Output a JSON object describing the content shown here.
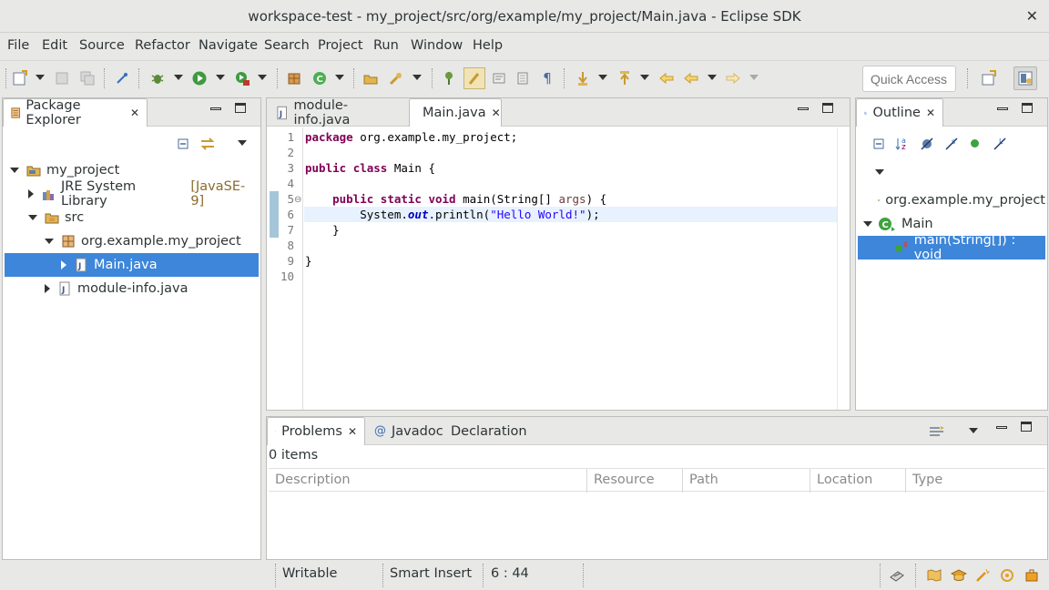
{
  "window": {
    "title": "workspace-test - my_project/src/org/example/my_project/Main.java - Eclipse SDK",
    "close_label": "✕"
  },
  "menu": [
    "File",
    "Edit",
    "Source",
    "Refactor",
    "Navigate",
    "Search",
    "Project",
    "Run",
    "Window",
    "Help"
  ],
  "toolbar": {
    "quick_access_placeholder": "Quick Access"
  },
  "package_explorer": {
    "tab_label": "Package Explorer",
    "tree": [
      {
        "label": "my_project",
        "decoration": ""
      },
      {
        "label": "JRE System Library",
        "decoration": "[JavaSE-9]"
      },
      {
        "label": "src",
        "decoration": ""
      },
      {
        "label": "org.example.my_project",
        "decoration": ""
      },
      {
        "label": "Main.java",
        "decoration": ""
      },
      {
        "label": "module-info.java",
        "decoration": ""
      }
    ]
  },
  "editor": {
    "tabs": [
      "module-info.java",
      "Main.java"
    ],
    "line_numbers": [
      "1",
      "2",
      "3",
      "4",
      "5",
      "6",
      "7",
      "8",
      "9",
      "10"
    ]
  },
  "outline": {
    "tab_label": "Outline",
    "items": [
      {
        "label": "org.example.my_project"
      },
      {
        "label": "Main"
      },
      {
        "label": "main(String[]) : void"
      }
    ]
  },
  "problems": {
    "tabs": [
      "Problems",
      "Javadoc",
      "Declaration"
    ],
    "count": "0 items",
    "columns": [
      "Description",
      "Resource",
      "Path",
      "Location",
      "Type"
    ]
  },
  "status": {
    "writable": "Writable",
    "insert_mode": "Smart Insert",
    "position": "6 : 44"
  }
}
